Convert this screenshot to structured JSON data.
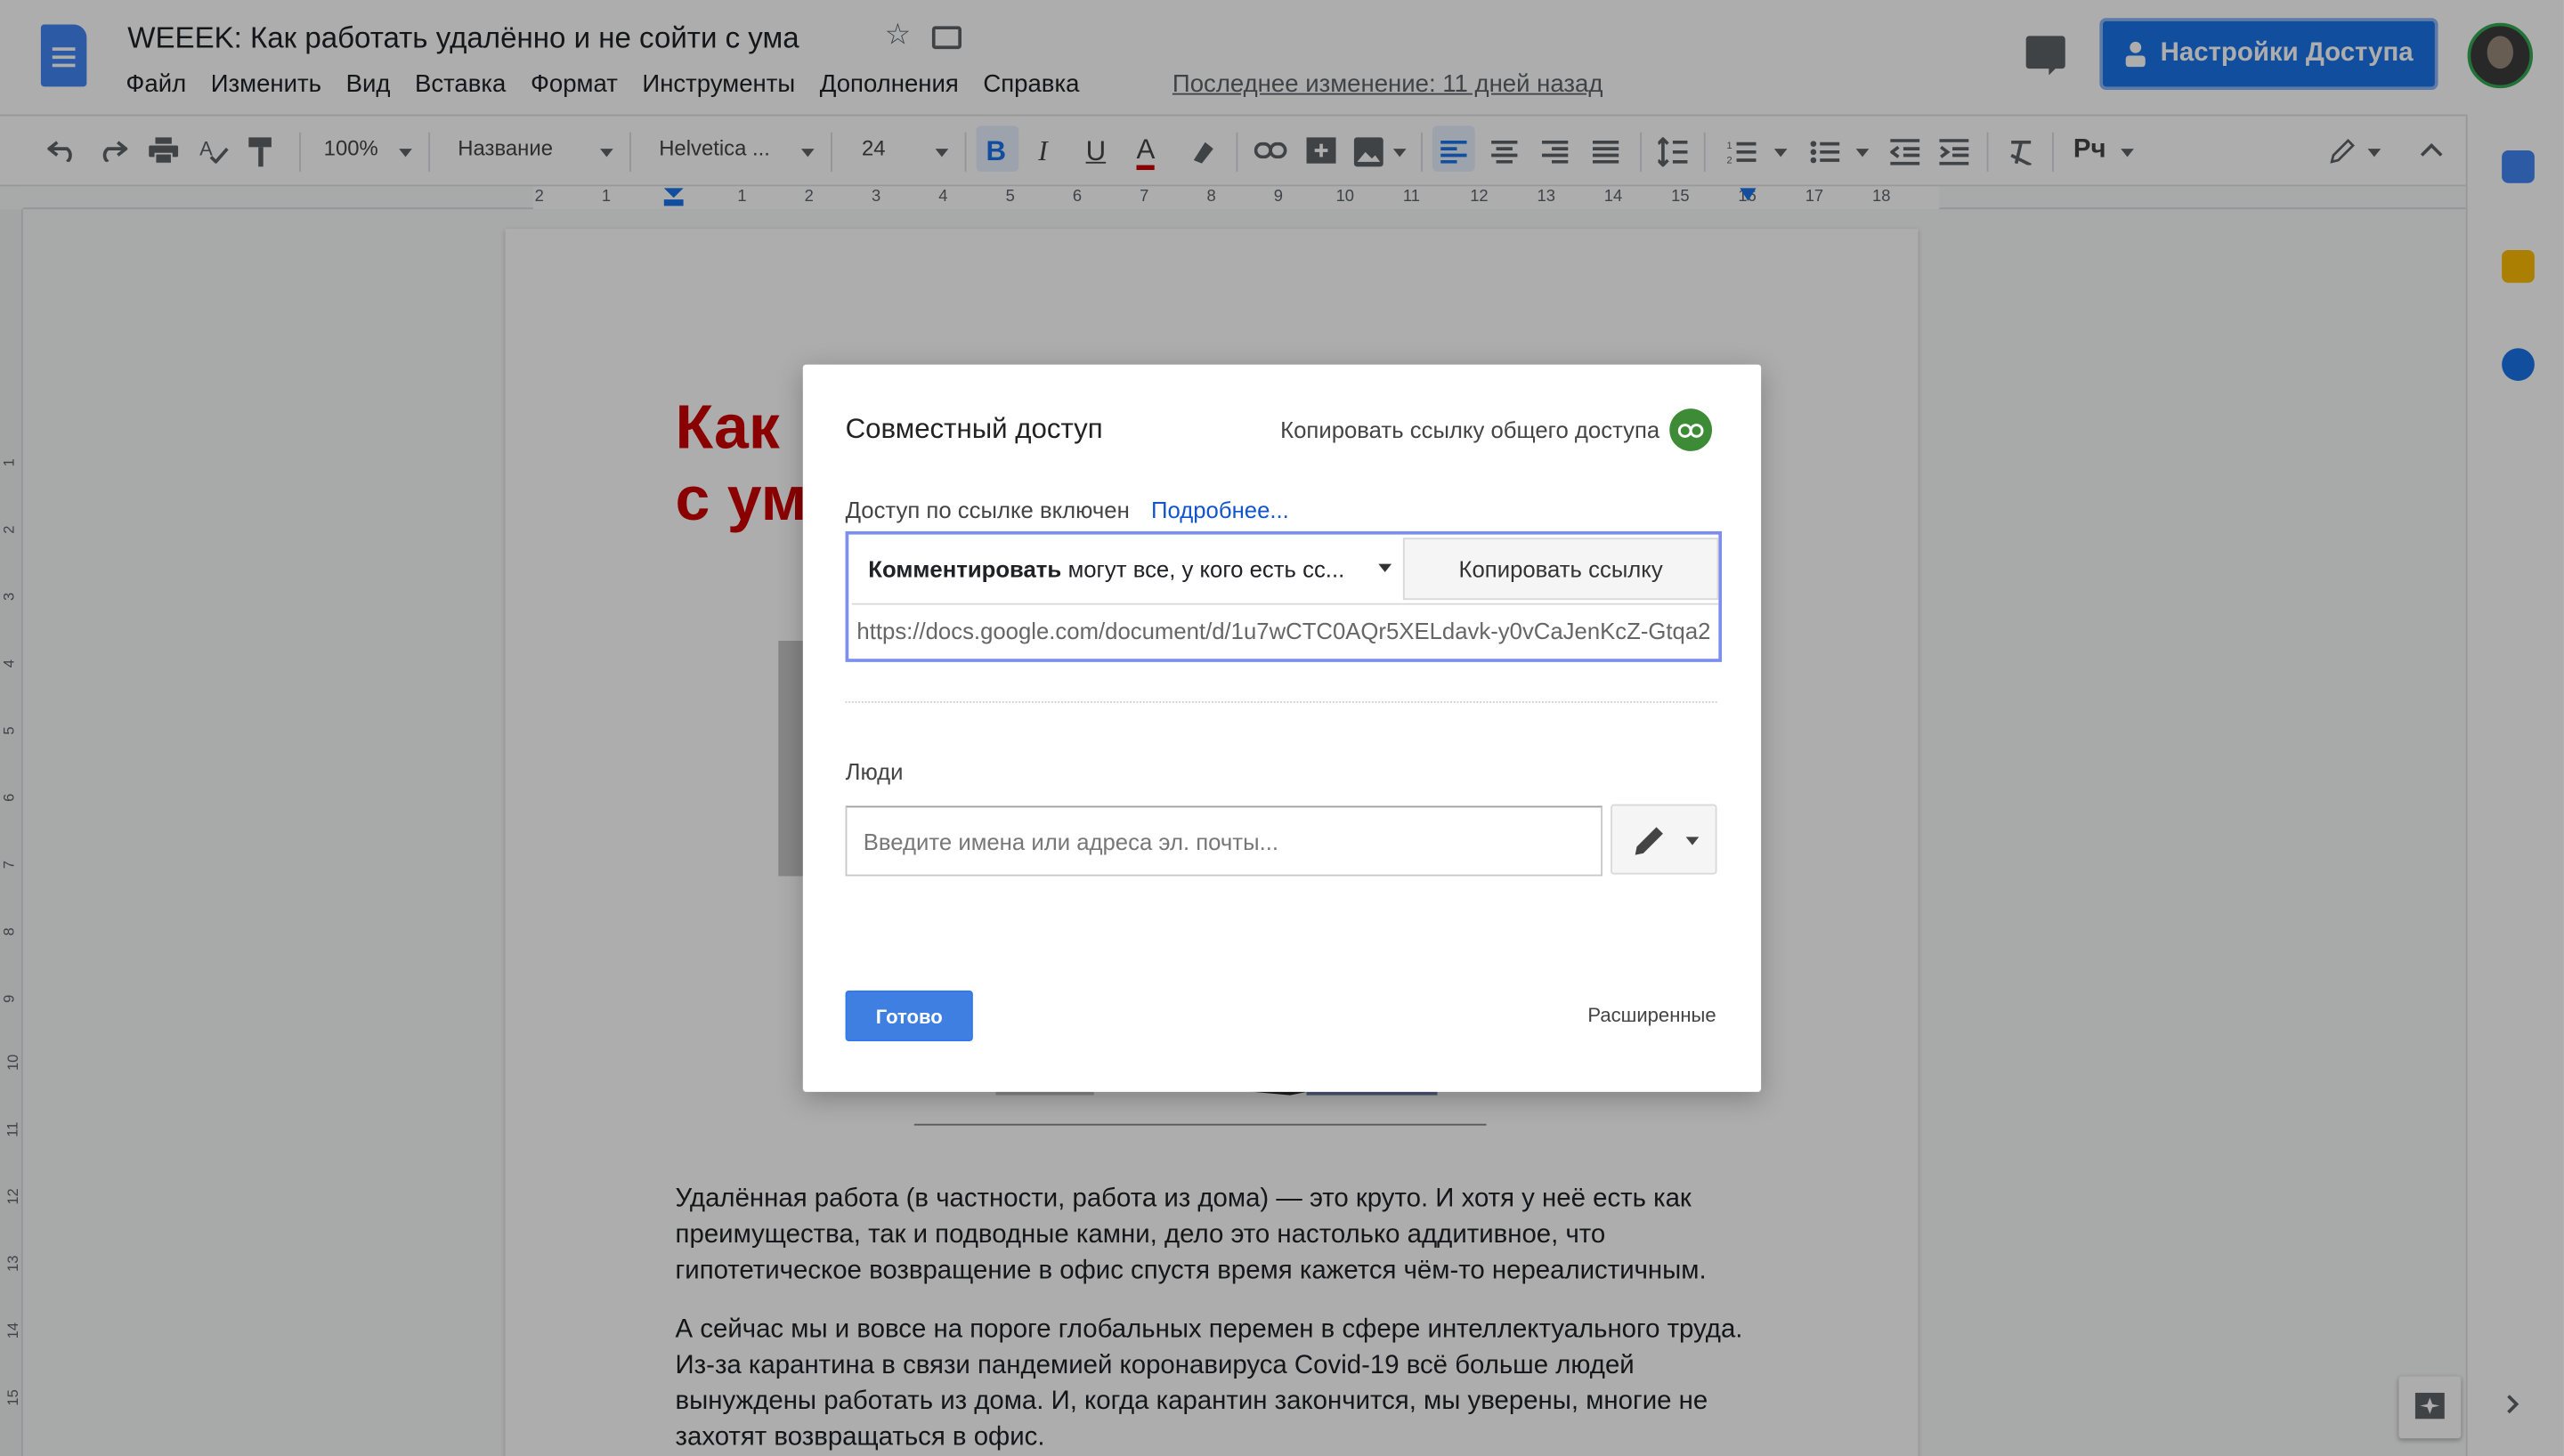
{
  "doc": {
    "title": "WEEEK: Как работать удалённо и не сойти с ума",
    "star_icon": "☆",
    "last_edit": "Последнее изменение: 11 дней назад"
  },
  "menu": [
    "Файл",
    "Изменить",
    "Вид",
    "Вставка",
    "Формат",
    "Инструменты",
    "Дополнения",
    "Справка"
  ],
  "share_button": "Настройки Доступа",
  "toolbar": {
    "zoom": "100%",
    "style": "Название",
    "font": "Helvetica ...",
    "size": "24",
    "bold": "B",
    "italic": "I",
    "underline": "U",
    "text_color": "A",
    "input_tools": "Pч"
  },
  "ruler": {
    "h_numbers": [
      "2",
      "1",
      "1",
      "2",
      "3",
      "4",
      "5",
      "6",
      "7",
      "8",
      "9",
      "10",
      "11",
      "12",
      "13",
      "14",
      "15",
      "16",
      "17",
      "18"
    ],
    "v_numbers": [
      "1",
      "2",
      "3",
      "4",
      "5",
      "6",
      "7",
      "8",
      "9",
      "10",
      "11",
      "12",
      "13",
      "14",
      "15"
    ]
  },
  "page": {
    "heading_line1": "Как",
    "heading_line2": "с ума",
    "para1": "Удалённая работа (в частности, работа из дома) — это круто. И хотя у неё есть как преимущества, так и подводные камни, дело это настолько аддитивное, что гипотетическое возвращение в офис спустя время кажется чём-то нереалистичным.",
    "para2": "А сейчас мы и вовсе на пороге глобальных перемен в сфере интеллектуального труда. Из-за карантина в связи пандемией коронавируса Covid-19 всё больше людей вынуждены работать из дома. И, когда карантин закончится, мы уверены, многие не захотят возвращаться в офис."
  },
  "dialog": {
    "title": "Совместный доступ",
    "copy_share_link": "Копировать ссылку общего доступа",
    "access_status": "Доступ по ссылке включен",
    "more_link": "Подробнее...",
    "permission_bold": "Комментировать",
    "permission_rest": "могут все, у кого есть сс...",
    "copy_link_button": "Копировать ссылку",
    "url": "https://docs.google.com/document/d/1u7wCTC0AQr5XELdavk-y0vCaJenKcZ-Gtqa2",
    "people_label": "Люди",
    "people_placeholder": "Введите имена или адреса эл. почты...",
    "done_button": "Готово",
    "advanced_link": "Расширенные"
  },
  "colors": {
    "accent": "#1a73e8",
    "heading_red": "#cc0000",
    "link_green": "#3d8b37",
    "done_blue": "#3f7fe2"
  }
}
